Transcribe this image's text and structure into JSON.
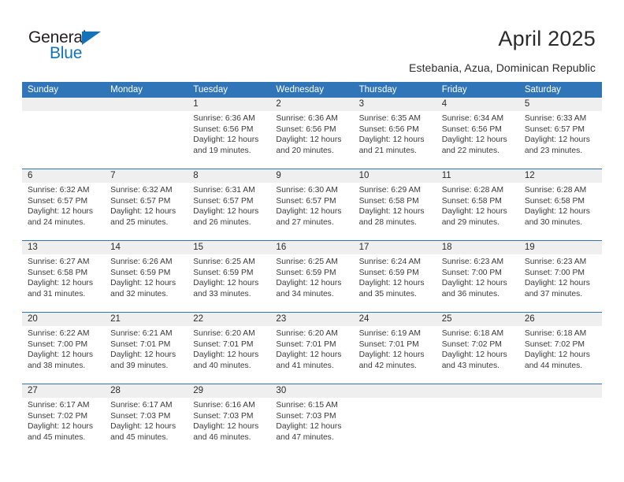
{
  "brand": {
    "word1": "General",
    "word2": "Blue",
    "triangle_color": "#1273ba",
    "text_color": "#231f20"
  },
  "header": {
    "title": "April 2025",
    "location": "Estebania, Azua, Dominican Republic"
  },
  "theme": {
    "header_blue": "#3075b8",
    "date_band_gray": "#efefef",
    "text": "#2b2b2b"
  },
  "weekday_headers": [
    "Sunday",
    "Monday",
    "Tuesday",
    "Wednesday",
    "Thursday",
    "Friday",
    "Saturday"
  ],
  "weeks": [
    {
      "days": [
        {
          "date": "",
          "lines": []
        },
        {
          "date": "",
          "lines": []
        },
        {
          "date": "1",
          "lines": [
            "Sunrise: 6:36 AM",
            "Sunset: 6:56 PM",
            "Daylight: 12 hours",
            "and 19 minutes."
          ]
        },
        {
          "date": "2",
          "lines": [
            "Sunrise: 6:36 AM",
            "Sunset: 6:56 PM",
            "Daylight: 12 hours",
            "and 20 minutes."
          ]
        },
        {
          "date": "3",
          "lines": [
            "Sunrise: 6:35 AM",
            "Sunset: 6:56 PM",
            "Daylight: 12 hours",
            "and 21 minutes."
          ]
        },
        {
          "date": "4",
          "lines": [
            "Sunrise: 6:34 AM",
            "Sunset: 6:56 PM",
            "Daylight: 12 hours",
            "and 22 minutes."
          ]
        },
        {
          "date": "5",
          "lines": [
            "Sunrise: 6:33 AM",
            "Sunset: 6:57 PM",
            "Daylight: 12 hours",
            "and 23 minutes."
          ]
        }
      ]
    },
    {
      "days": [
        {
          "date": "6",
          "lines": [
            "Sunrise: 6:32 AM",
            "Sunset: 6:57 PM",
            "Daylight: 12 hours",
            "and 24 minutes."
          ]
        },
        {
          "date": "7",
          "lines": [
            "Sunrise: 6:32 AM",
            "Sunset: 6:57 PM",
            "Daylight: 12 hours",
            "and 25 minutes."
          ]
        },
        {
          "date": "8",
          "lines": [
            "Sunrise: 6:31 AM",
            "Sunset: 6:57 PM",
            "Daylight: 12 hours",
            "and 26 minutes."
          ]
        },
        {
          "date": "9",
          "lines": [
            "Sunrise: 6:30 AM",
            "Sunset: 6:57 PM",
            "Daylight: 12 hours",
            "and 27 minutes."
          ]
        },
        {
          "date": "10",
          "lines": [
            "Sunrise: 6:29 AM",
            "Sunset: 6:58 PM",
            "Daylight: 12 hours",
            "and 28 minutes."
          ]
        },
        {
          "date": "11",
          "lines": [
            "Sunrise: 6:28 AM",
            "Sunset: 6:58 PM",
            "Daylight: 12 hours",
            "and 29 minutes."
          ]
        },
        {
          "date": "12",
          "lines": [
            "Sunrise: 6:28 AM",
            "Sunset: 6:58 PM",
            "Daylight: 12 hours",
            "and 30 minutes."
          ]
        }
      ]
    },
    {
      "days": [
        {
          "date": "13",
          "lines": [
            "Sunrise: 6:27 AM",
            "Sunset: 6:58 PM",
            "Daylight: 12 hours",
            "and 31 minutes."
          ]
        },
        {
          "date": "14",
          "lines": [
            "Sunrise: 6:26 AM",
            "Sunset: 6:59 PM",
            "Daylight: 12 hours",
            "and 32 minutes."
          ]
        },
        {
          "date": "15",
          "lines": [
            "Sunrise: 6:25 AM",
            "Sunset: 6:59 PM",
            "Daylight: 12 hours",
            "and 33 minutes."
          ]
        },
        {
          "date": "16",
          "lines": [
            "Sunrise: 6:25 AM",
            "Sunset: 6:59 PM",
            "Daylight: 12 hours",
            "and 34 minutes."
          ]
        },
        {
          "date": "17",
          "lines": [
            "Sunrise: 6:24 AM",
            "Sunset: 6:59 PM",
            "Daylight: 12 hours",
            "and 35 minutes."
          ]
        },
        {
          "date": "18",
          "lines": [
            "Sunrise: 6:23 AM",
            "Sunset: 7:00 PM",
            "Daylight: 12 hours",
            "and 36 minutes."
          ]
        },
        {
          "date": "19",
          "lines": [
            "Sunrise: 6:23 AM",
            "Sunset: 7:00 PM",
            "Daylight: 12 hours",
            "and 37 minutes."
          ]
        }
      ]
    },
    {
      "days": [
        {
          "date": "20",
          "lines": [
            "Sunrise: 6:22 AM",
            "Sunset: 7:00 PM",
            "Daylight: 12 hours",
            "and 38 minutes."
          ]
        },
        {
          "date": "21",
          "lines": [
            "Sunrise: 6:21 AM",
            "Sunset: 7:01 PM",
            "Daylight: 12 hours",
            "and 39 minutes."
          ]
        },
        {
          "date": "22",
          "lines": [
            "Sunrise: 6:20 AM",
            "Sunset: 7:01 PM",
            "Daylight: 12 hours",
            "and 40 minutes."
          ]
        },
        {
          "date": "23",
          "lines": [
            "Sunrise: 6:20 AM",
            "Sunset: 7:01 PM",
            "Daylight: 12 hours",
            "and 41 minutes."
          ]
        },
        {
          "date": "24",
          "lines": [
            "Sunrise: 6:19 AM",
            "Sunset: 7:01 PM",
            "Daylight: 12 hours",
            "and 42 minutes."
          ]
        },
        {
          "date": "25",
          "lines": [
            "Sunrise: 6:18 AM",
            "Sunset: 7:02 PM",
            "Daylight: 12 hours",
            "and 43 minutes."
          ]
        },
        {
          "date": "26",
          "lines": [
            "Sunrise: 6:18 AM",
            "Sunset: 7:02 PM",
            "Daylight: 12 hours",
            "and 44 minutes."
          ]
        }
      ]
    },
    {
      "days": [
        {
          "date": "27",
          "lines": [
            "Sunrise: 6:17 AM",
            "Sunset: 7:02 PM",
            "Daylight: 12 hours",
            "and 45 minutes."
          ]
        },
        {
          "date": "28",
          "lines": [
            "Sunrise: 6:17 AM",
            "Sunset: 7:03 PM",
            "Daylight: 12 hours",
            "and 45 minutes."
          ]
        },
        {
          "date": "29",
          "lines": [
            "Sunrise: 6:16 AM",
            "Sunset: 7:03 PM",
            "Daylight: 12 hours",
            "and 46 minutes."
          ]
        },
        {
          "date": "30",
          "lines": [
            "Sunrise: 6:15 AM",
            "Sunset: 7:03 PM",
            "Daylight: 12 hours",
            "and 47 minutes."
          ]
        },
        {
          "date": "",
          "lines": []
        },
        {
          "date": "",
          "lines": []
        },
        {
          "date": "",
          "lines": []
        }
      ]
    }
  ]
}
